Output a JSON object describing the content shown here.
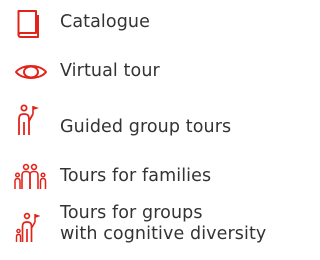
{
  "menu": {
    "accent": "#e2231a",
    "items": [
      {
        "icon": "book-icon",
        "line1": "Catalogue",
        "line2": ""
      },
      {
        "icon": "eye-icon",
        "line1": "Virtual tour",
        "line2": ""
      },
      {
        "icon": "guide-with-flag-icon",
        "line1": "Guided group tours",
        "line2": ""
      },
      {
        "icon": "family-icon",
        "line1": "Tours for families",
        "line2": ""
      },
      {
        "icon": "guide-with-group-icon",
        "line1": "Tours for groups",
        "line2": "with cognitive diversity"
      }
    ]
  }
}
